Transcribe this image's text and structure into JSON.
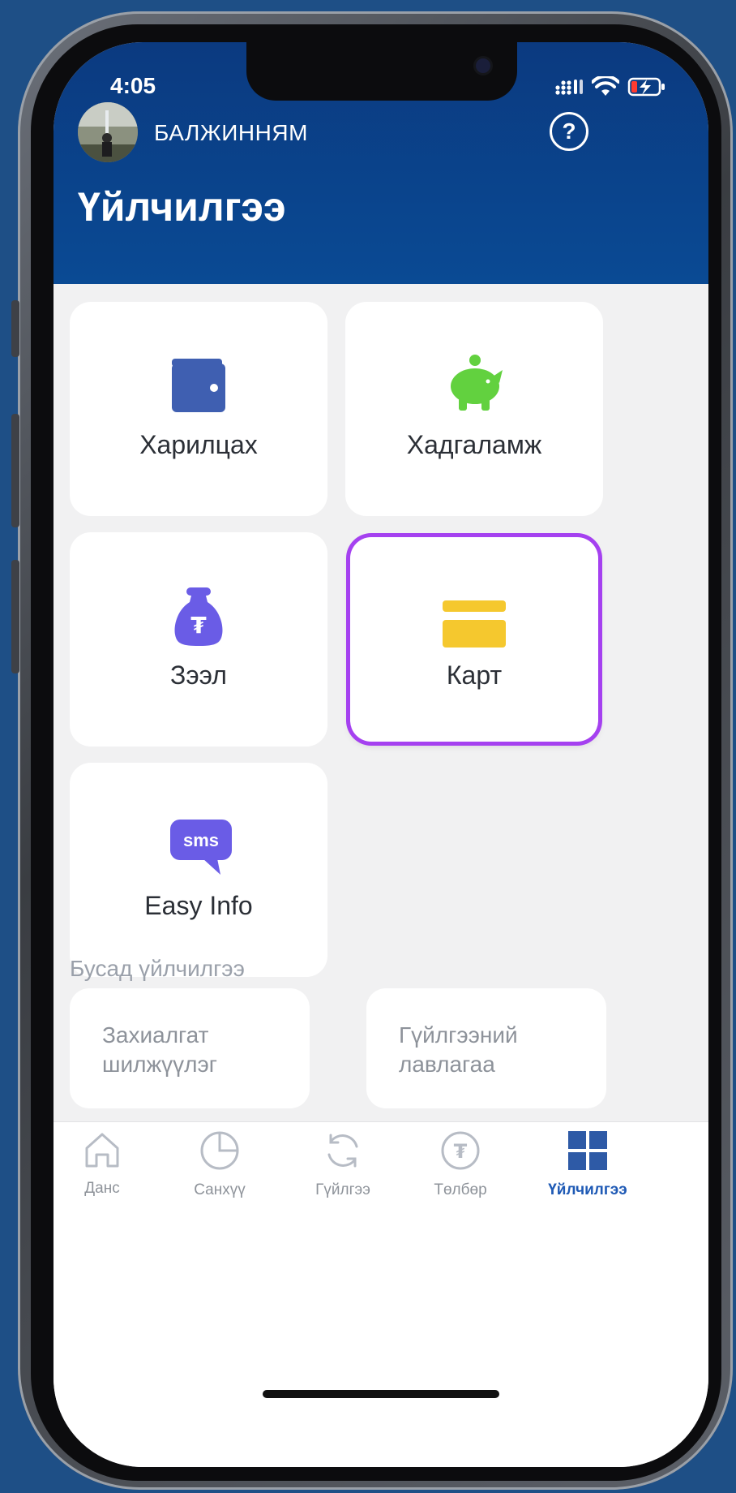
{
  "status_bar": {
    "time": "4:05"
  },
  "header": {
    "user_name": "БАЛЖИННЯМ",
    "help_symbol": "?",
    "title": "Үйлчилгээ"
  },
  "services": [
    {
      "label": "Харилцах",
      "icon": "wallet-icon",
      "color": "#3f5fb1"
    },
    {
      "label": "Хадгаламж",
      "icon": "piggy-bank-icon",
      "color": "#62d13f"
    },
    {
      "label": "Зээл",
      "icon": "money-bag-icon",
      "color": "#6a5ce6",
      "symbol": "₮"
    },
    {
      "label": "Карт",
      "icon": "card-icon",
      "color": "#f5c82e",
      "selected": true
    },
    {
      "label": "Easy Info",
      "icon": "sms-icon",
      "color": "#6a5ce6",
      "symbol": "sms"
    }
  ],
  "other_section": {
    "title": "Бусад үйлчилгээ",
    "items": [
      {
        "label": "Захиалгат шилжүүлэг"
      },
      {
        "label": "Гүйлгээний лавлагаа"
      }
    ]
  },
  "tab_bar": {
    "active": "Үйлчилгээ",
    "tabs": [
      {
        "label": "Данс",
        "icon": "home-icon"
      },
      {
        "label": "Санхүү",
        "icon": "pie-chart-icon"
      },
      {
        "label": "Гүйлгээ",
        "icon": "refresh-icon"
      },
      {
        "label": "Төлбөр",
        "icon": "tugrik-coin-icon",
        "symbol": "₮"
      },
      {
        "label": "Үйлчилгээ",
        "icon": "grid-icon"
      }
    ]
  },
  "colors": {
    "header": "#0b3a80",
    "accent": "#1f5ab5",
    "highlight": "#a541f0"
  }
}
